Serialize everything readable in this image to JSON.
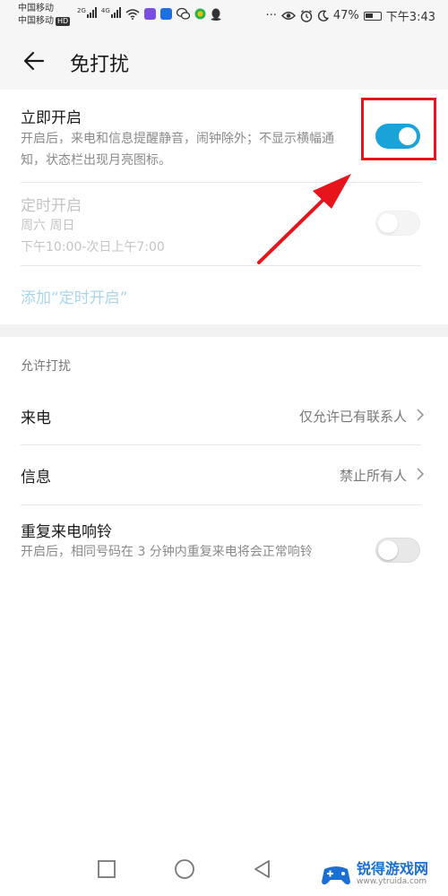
{
  "status_bar": {
    "carrier1": "中国移动",
    "carrier2": "中国移动",
    "hd": "HD",
    "net1": "2G",
    "net2": "4G",
    "dots": "···",
    "battery": "47%",
    "time": "下午3:43"
  },
  "header": {
    "title": "免打扰"
  },
  "immediate": {
    "title": "立即开启",
    "desc": "开启后，来电和信息提醒静音，闹钟除外；不显示横幅通知，状态栏出现月亮图标。",
    "enabled": true
  },
  "scheduled": {
    "title": "定时开启",
    "days": "周六 周日",
    "time_range": "下午10:00-次日上午7:00",
    "enabled": false
  },
  "add_schedule": "添加“定时开启”",
  "allow_section": {
    "label": "允许打扰",
    "calls": {
      "title": "来电",
      "value": "仅允许已有联系人"
    },
    "messages": {
      "title": "信息",
      "value": "禁止所有人"
    },
    "repeat": {
      "title": "重复来电响铃",
      "desc": "开启后，相同号码在 3 分钟内重复来电将会正常响铃",
      "enabled": false
    }
  },
  "watermark": {
    "name": "锐得游戏网",
    "url": "www.ytruida.com"
  },
  "colors": {
    "accent": "#1aa3d8",
    "annotation": "#e8141c",
    "link": "#a9d6ee"
  }
}
